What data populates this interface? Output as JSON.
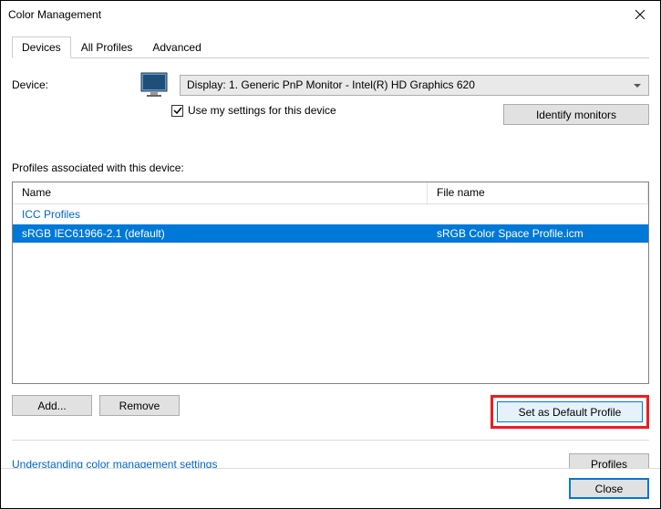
{
  "title": "Color Management",
  "tabs": {
    "devices": "Devices",
    "allProfiles": "All Profiles",
    "advanced": "Advanced"
  },
  "device": {
    "label": "Device:",
    "selected": "Display: 1. Generic PnP Monitor - Intel(R) HD Graphics 620",
    "useMySettings": "Use my settings for this device",
    "identifyMonitors": "Identify monitors"
  },
  "profiles": {
    "label": "Profiles associated with this device:",
    "columns": {
      "name": "Name",
      "fileName": "File name"
    },
    "groupHeader": "ICC Profiles",
    "rows": [
      {
        "name": "sRGB IEC61966-2.1 (default)",
        "fileName": "sRGB Color Space Profile.icm"
      }
    ]
  },
  "buttons": {
    "add": "Add...",
    "remove": "Remove",
    "setDefault": "Set as Default Profile",
    "profiles": "Profiles",
    "close": "Close"
  },
  "link": "Understanding color management settings"
}
